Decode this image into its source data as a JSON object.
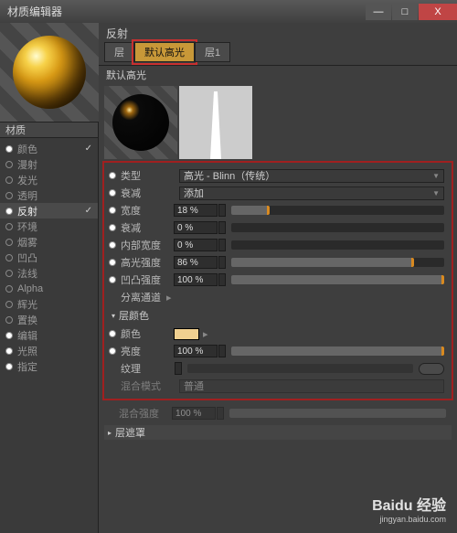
{
  "title": "材质编辑器",
  "win": {
    "min": "—",
    "max": "□",
    "close": "X"
  },
  "material_name": "材质",
  "channels": [
    {
      "name": "颜色",
      "dot": true,
      "check": true,
      "sel": false
    },
    {
      "name": "漫射",
      "dot": false,
      "check": false,
      "sel": false
    },
    {
      "name": "发光",
      "dot": false,
      "check": false,
      "sel": false
    },
    {
      "name": "透明",
      "dot": false,
      "check": false,
      "sel": false
    },
    {
      "name": "反射",
      "dot": true,
      "check": true,
      "sel": true
    },
    {
      "name": "环境",
      "dot": false,
      "check": false,
      "sel": false
    },
    {
      "name": "烟雾",
      "dot": false,
      "check": false,
      "sel": false
    },
    {
      "name": "凹凸",
      "dot": false,
      "check": false,
      "sel": false
    },
    {
      "name": "法线",
      "dot": false,
      "check": false,
      "sel": false
    },
    {
      "name": "Alpha",
      "dot": false,
      "check": false,
      "sel": false
    },
    {
      "name": "辉光",
      "dot": false,
      "check": false,
      "sel": false
    },
    {
      "name": "置换",
      "dot": false,
      "check": false,
      "sel": false
    },
    {
      "name": "编辑",
      "dot": true,
      "check": false,
      "sel": false
    },
    {
      "name": "光照",
      "dot": true,
      "check": false,
      "sel": false
    },
    {
      "name": "指定",
      "dot": true,
      "check": false,
      "sel": false
    }
  ],
  "right_header": "反射",
  "tabs": {
    "t1": "层",
    "t2": "默认高光",
    "t3": "层1"
  },
  "layer_label": "默认高光",
  "params": {
    "type_label": "类型",
    "type_value": "高光 - Blinn（传统）",
    "atten_label": "衰减",
    "atten_value": "添加",
    "rows": [
      {
        "label": "宽度",
        "value": "18 %",
        "pct": 18
      },
      {
        "label": "衰减",
        "value": "0 %",
        "pct": 0
      },
      {
        "label": "内部宽度",
        "value": "0 %",
        "pct": 0
      },
      {
        "label": "高光强度",
        "value": "86 %",
        "pct": 86
      },
      {
        "label": "凹凸强度",
        "value": "100 %",
        "pct": 100
      }
    ],
    "sep_channels": "分离通道",
    "layer_color_head": "层颜色",
    "color_label": "颜色",
    "bright_label": "亮度",
    "bright_value": "100 %",
    "tex_label": "纹理",
    "blend_label": "混合模式",
    "blend_value": "普通",
    "mix_label": "混合强度",
    "mix_value": "100 %",
    "mask_head": "层遮罩"
  },
  "watermark": {
    "brand": "Baidu 经验",
    "sub": "jingyan.baidu.com"
  }
}
